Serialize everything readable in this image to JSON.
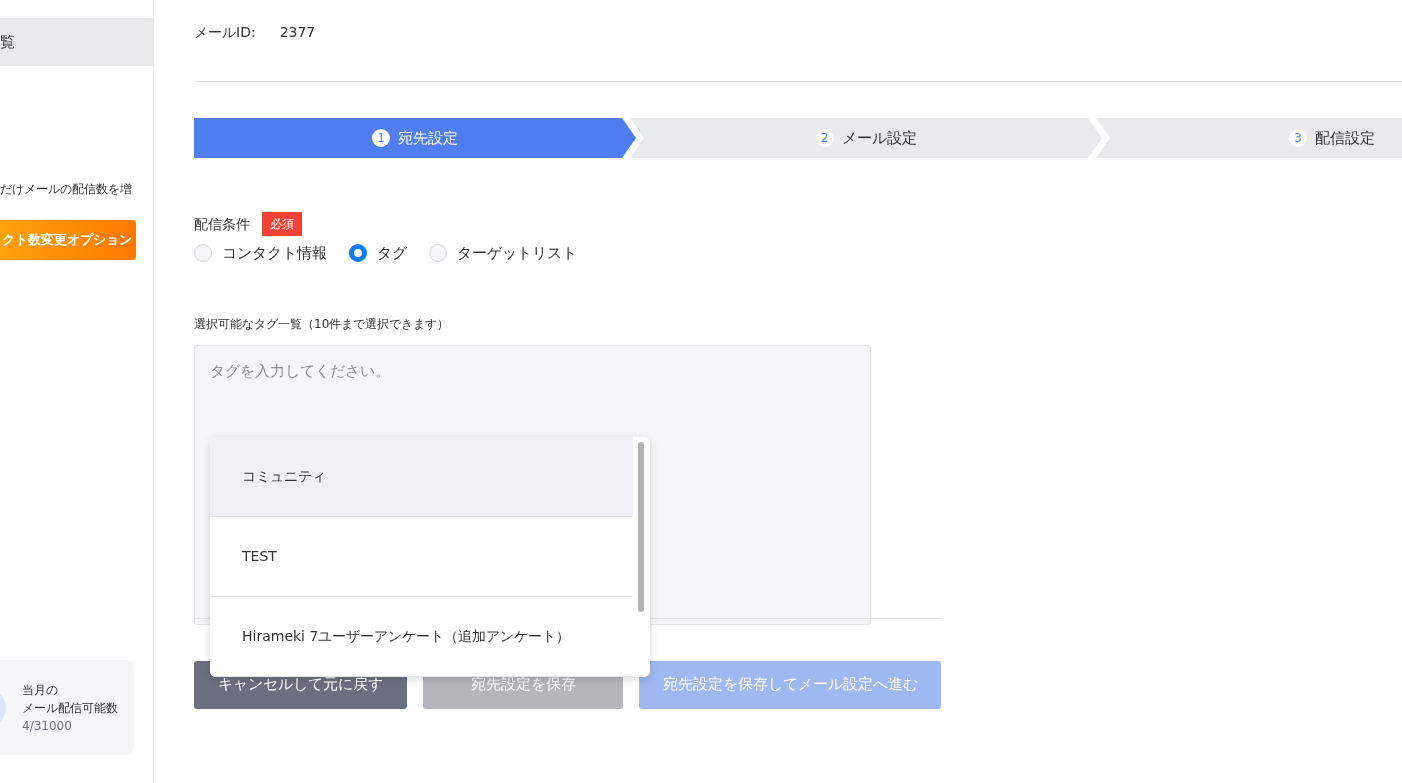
{
  "sidebar": {
    "menu_item": {
      "label": "覧",
      "selected": true
    },
    "promo_text": "だけメールの配信数を増",
    "promo_button": "クト数変更オプション",
    "quota_card": {
      "title_line_1": "当月の",
      "title_line_2": "メール配信可能数",
      "count": "4/31000"
    }
  },
  "mail_id": {
    "label": "メールID:",
    "value": "2377"
  },
  "steps": [
    {
      "number": "1",
      "label": "宛先設定",
      "selected": true
    },
    {
      "number": "2",
      "label": "メール設定",
      "selected": false
    },
    {
      "number": "3",
      "label": "配信設定",
      "selected": false
    }
  ],
  "condition": {
    "label": "配信条件",
    "required_badge": "必須",
    "options": [
      {
        "label": "コンタクト情報",
        "selected": false
      },
      {
        "label": "タグ",
        "selected": true
      },
      {
        "label": "ターゲットリスト",
        "selected": false
      }
    ]
  },
  "tag_field": {
    "label": "選択可能なタグ一覧（10件まで選択できます）",
    "placeholder": "タグを入力してください。",
    "suggestions": [
      {
        "label": "コミュニティ",
        "highlighted": true
      },
      {
        "label": "TEST",
        "highlighted": false
      },
      {
        "label": "Hirameki 7ユーザーアンケート（追加アンケート）",
        "highlighted": false
      }
    ]
  },
  "buttons": [
    {
      "label": "キャンセルして元に戻す",
      "kind": "cancel",
      "disabled": false
    },
    {
      "label": "宛先設定を保存",
      "kind": "save",
      "disabled": true
    },
    {
      "label": "宛先設定を保存してメール設定へ進む",
      "kind": "next",
      "disabled": true
    }
  ]
}
